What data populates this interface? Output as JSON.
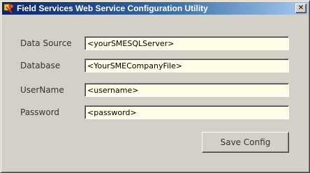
{
  "window": {
    "title": "Field Services Web Service Configuration Utility",
    "close_glyph": "✕",
    "title_icon": "app-gear-icon"
  },
  "form": {
    "fields": [
      {
        "label": "Data Source",
        "value": "<yourSMESQLServer>"
      },
      {
        "label": "Database",
        "value": "<YourSMECompanyFile>"
      },
      {
        "label": "UserName",
        "value": "<username>"
      },
      {
        "label": "Password",
        "value": "<password>"
      }
    ]
  },
  "actions": {
    "save_label": "Save Config"
  },
  "colors": {
    "title_gradient_start": "#0a246a",
    "title_gradient_end": "#a6caf0",
    "input_background": "#fffde8",
    "window_background": "#d4d0c8"
  }
}
